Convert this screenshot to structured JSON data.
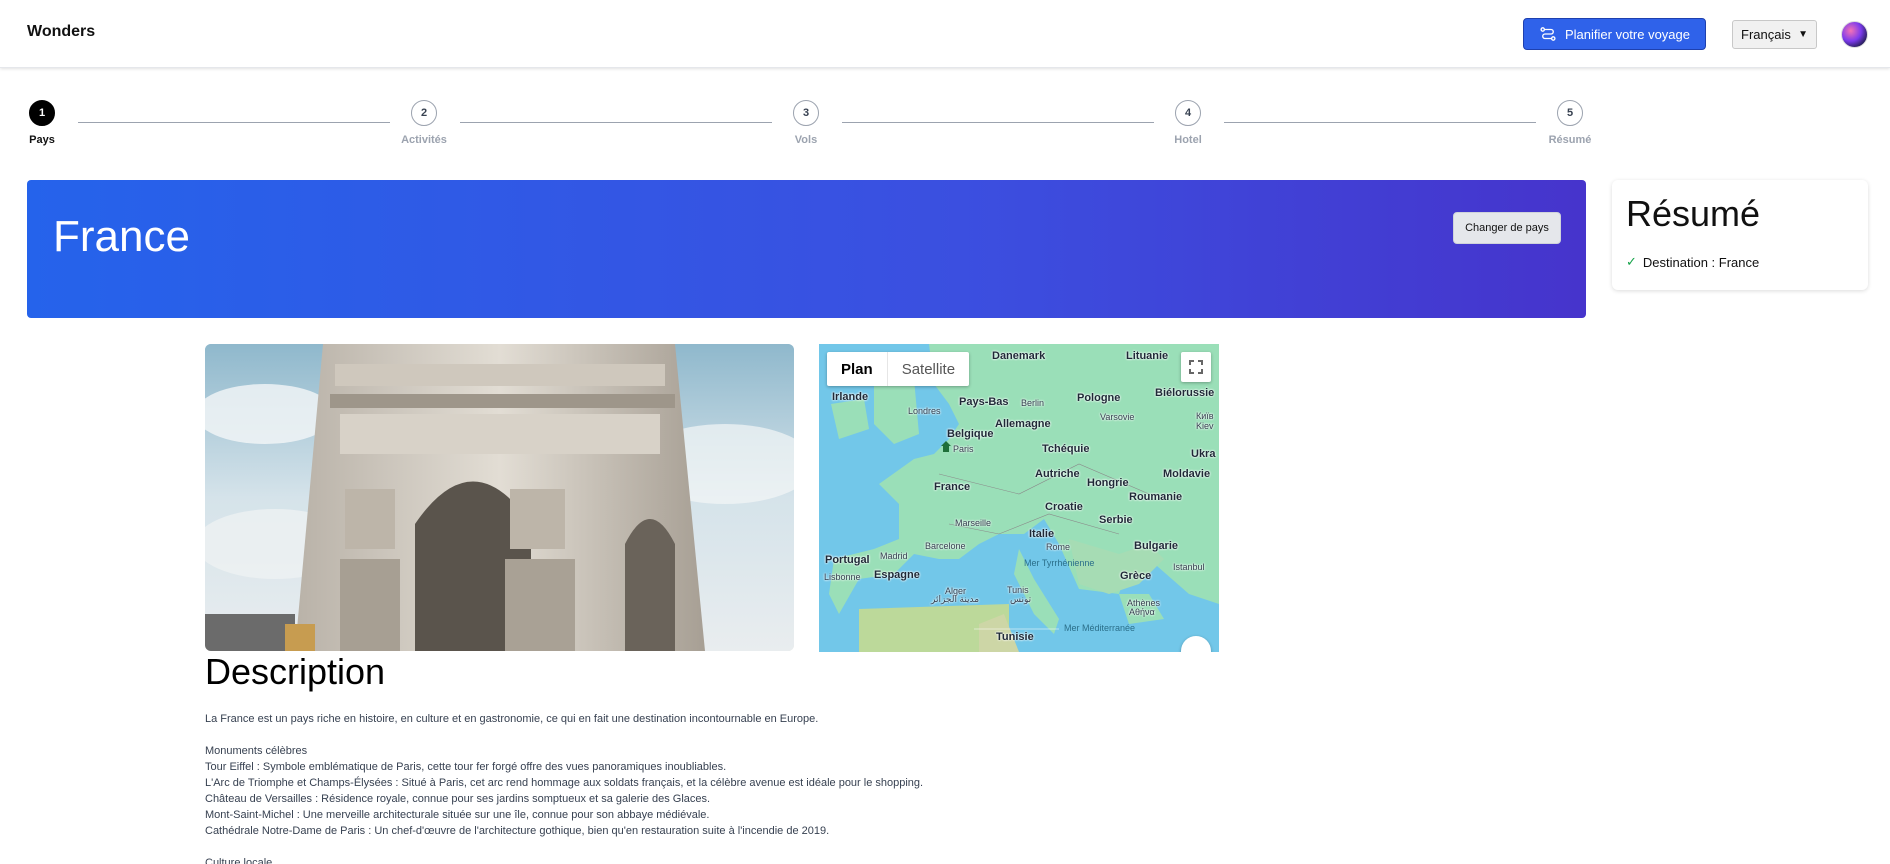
{
  "header": {
    "brand": "Wonders",
    "plan_button": "Planifier votre voyage",
    "language": "Français"
  },
  "stepper": {
    "steps": [
      {
        "number": "1",
        "label": "Pays"
      },
      {
        "number": "2",
        "label": "Activités"
      },
      {
        "number": "3",
        "label": "Vols"
      },
      {
        "number": "4",
        "label": "Hotel"
      },
      {
        "number": "5",
        "label": "Résumé"
      }
    ]
  },
  "hero": {
    "country": "France",
    "change_button": "Changer de pays"
  },
  "summary": {
    "title": "Résumé",
    "destination": "Destination : France"
  },
  "map": {
    "tabs": [
      "Plan",
      "Satellite"
    ],
    "labels": {
      "danemark": "Danemark",
      "lituanie": "Lituanie",
      "irlande": "Irlande",
      "pays_bas": "Pays-Bas",
      "berlin": "Berlin",
      "pologne": "Pologne",
      "bielorussie": "Biélorussie",
      "londres": "Londres",
      "belgique": "Belgique",
      "allemagne": "Allemagne",
      "varsovie": "Varsovie",
      "kiev": "Київ",
      "kiev2": "Kiev",
      "paris": "Paris",
      "tcheque": "Tchéquie",
      "ukra": "Ukra",
      "france": "France",
      "autriche": "Autriche",
      "hongrie": "Hongrie",
      "moldavie": "Moldavie",
      "croatie": "Croatie",
      "roumanie": "Roumanie",
      "marseille": "Marseille",
      "serbie": "Serbie",
      "italie": "Italie",
      "barcelone": "Barcelone",
      "rome": "Rome",
      "bulgarie": "Bulgarie",
      "portugal": "Portugal",
      "madrid": "Madrid",
      "mer_tyr": "Mer Tyrrhénienne",
      "istanbul": "Istanbul",
      "lisbonne": "Lisbonne",
      "espagne": "Espagne",
      "grece": "Grèce",
      "alger": "Alger",
      "alger_ar": "مدينة الجزائر",
      "tunis": "Tunis",
      "tunis_ar": "تونس",
      "athenes": "Athènes",
      "athenes_gr": "Αθήνα",
      "tunisie": "Tunisie",
      "mer_med": "Mer Méditerranée"
    }
  },
  "description": {
    "title": "Description",
    "intro": "La France est un pays riche en histoire, en culture et en gastronomie, ce qui en fait une destination incontournable en Europe.",
    "monuments_heading": "Monuments célèbres",
    "monuments": [
      "Tour Eiffel : Symbole emblématique de Paris, cette tour fer forgé offre des vues panoramiques inoubliables.",
      "L'Arc de Triomphe et Champs-Élysées : Situé à Paris, cet arc rend hommage aux soldats français, et la célèbre avenue est idéale pour le shopping.",
      "Château de Versailles : Résidence royale, connue pour ses jardins somptueux et sa galerie des Glaces.",
      "Mont-Saint-Michel : Une merveille architecturale située sur une île, connue pour son abbaye médiévale.",
      "Cathédrale Notre-Dame de Paris : Un chef-d'œuvre de l'architecture gothique, bien qu'en restauration suite à l'incendie de 2019."
    ],
    "culture_heading": "Culture locale"
  }
}
